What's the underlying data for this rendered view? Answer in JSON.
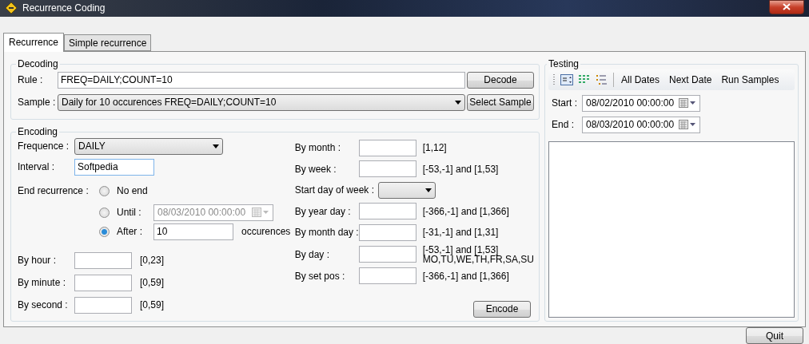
{
  "window": {
    "title": "Recurrence Coding"
  },
  "tabs": [
    {
      "label": "Recurrence",
      "selected": true
    },
    {
      "label": "Simple recurrence",
      "selected": false
    }
  ],
  "decoding": {
    "title": "Decoding",
    "rule": {
      "label": "Rule :",
      "value": "FREQ=DAILY;COUNT=10"
    },
    "sample": {
      "label": "Sample :",
      "value": "Daily for 10 occurences FREQ=DAILY;COUNT=10"
    },
    "decode_button": "Decode",
    "sample_button": "Select Sample"
  },
  "encoding": {
    "title": "Encoding",
    "frequence": {
      "label": "Frequence :",
      "value": "DAILY"
    },
    "interval": {
      "label": "Interval :",
      "value": "Softpedia"
    },
    "end_recurrence": {
      "label": "End recurrence :",
      "options": [
        {
          "label": "No end",
          "selected": false
        },
        {
          "kind": "date",
          "label": "Until :",
          "selected": false,
          "value": "08/03/2010 00:00:00",
          "disabled": true
        },
        {
          "kind": "count",
          "label": "After :",
          "selected": true,
          "value": "10",
          "suffix": "occurences"
        }
      ]
    },
    "time_fields": [
      {
        "label": "By hour :",
        "hint": "[0,23]"
      },
      {
        "label": "By minute :",
        "hint": "[0,59]"
      },
      {
        "label": "By second :",
        "hint": "[0,59]"
      }
    ],
    "rule_fields": [
      {
        "kind": "field",
        "label": "By month :",
        "hints": [
          "[1,12]"
        ]
      },
      {
        "kind": "field",
        "label": "By week :",
        "hints": [
          "[-53,-1] and [1,53]"
        ]
      },
      {
        "kind": "dropdown",
        "label": "Start day of week :"
      },
      {
        "kind": "field",
        "label": "By year day :",
        "hints": [
          "[-366,-1] and [1,366]"
        ]
      },
      {
        "kind": "field",
        "label": "By month day :",
        "hints": [
          "[-31,-1] and [1,31]"
        ]
      },
      {
        "kind": "field",
        "label": "By day :",
        "hints": [
          "[-53,-1] and [1,53]",
          "MO,TU,WE,TH,FR,SA,SU"
        ]
      },
      {
        "kind": "field",
        "label": "By set pos :",
        "hints": [
          "[-366,-1] and [1,366]"
        ]
      }
    ],
    "encode_button": "Encode"
  },
  "testing": {
    "title": "Testing",
    "toolbar": [
      "All Dates",
      "Next Date",
      "Run Samples"
    ],
    "start": {
      "label": "Start :",
      "value": "08/02/2010 00:00:00"
    },
    "end": {
      "label": "End :",
      "value": "08/03/2010 00:00:00"
    }
  },
  "quit_button": "Quit"
}
